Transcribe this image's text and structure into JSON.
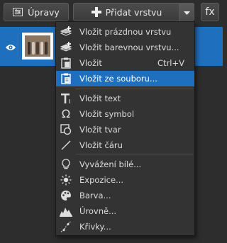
{
  "toolbar": {
    "adjust_label": "Úpravy",
    "add_layer_label": "Přidat vrstvu",
    "fx_label": "fx"
  },
  "menu": {
    "items": [
      {
        "label": "Vložit prázdnou vrstvu",
        "icon": "empty-layer-icon"
      },
      {
        "label": "Vložit barevnou vrstvu...",
        "icon": "color-layer-icon"
      },
      {
        "label": "Vložit",
        "shortcut": "Ctrl+V",
        "icon": "paste-icon"
      },
      {
        "label": "Vložit ze souboru...",
        "icon": "paste-from-file-icon",
        "selected": true
      },
      {
        "label": "Vložit text",
        "icon": "text-icon"
      },
      {
        "label": "Vložit symbol",
        "icon": "omega-symbol-icon"
      },
      {
        "label": "Vložit tvar",
        "icon": "shape-icon"
      },
      {
        "label": "Vložit čáru",
        "icon": "line-icon"
      },
      {
        "label": "Vyvážení bílé...",
        "icon": "bulb-icon"
      },
      {
        "label": "Expozice...",
        "icon": "sun-icon"
      },
      {
        "label": "Barva...",
        "icon": "palette-icon"
      },
      {
        "label": "Úrovně...",
        "icon": "histogram-icon"
      },
      {
        "label": "Křivky...",
        "icon": "curve-icon"
      }
    ]
  },
  "colors": {
    "accent": "#1f6fbf",
    "menu_bg": "#333333",
    "app_bg": "#2d2d2d"
  }
}
